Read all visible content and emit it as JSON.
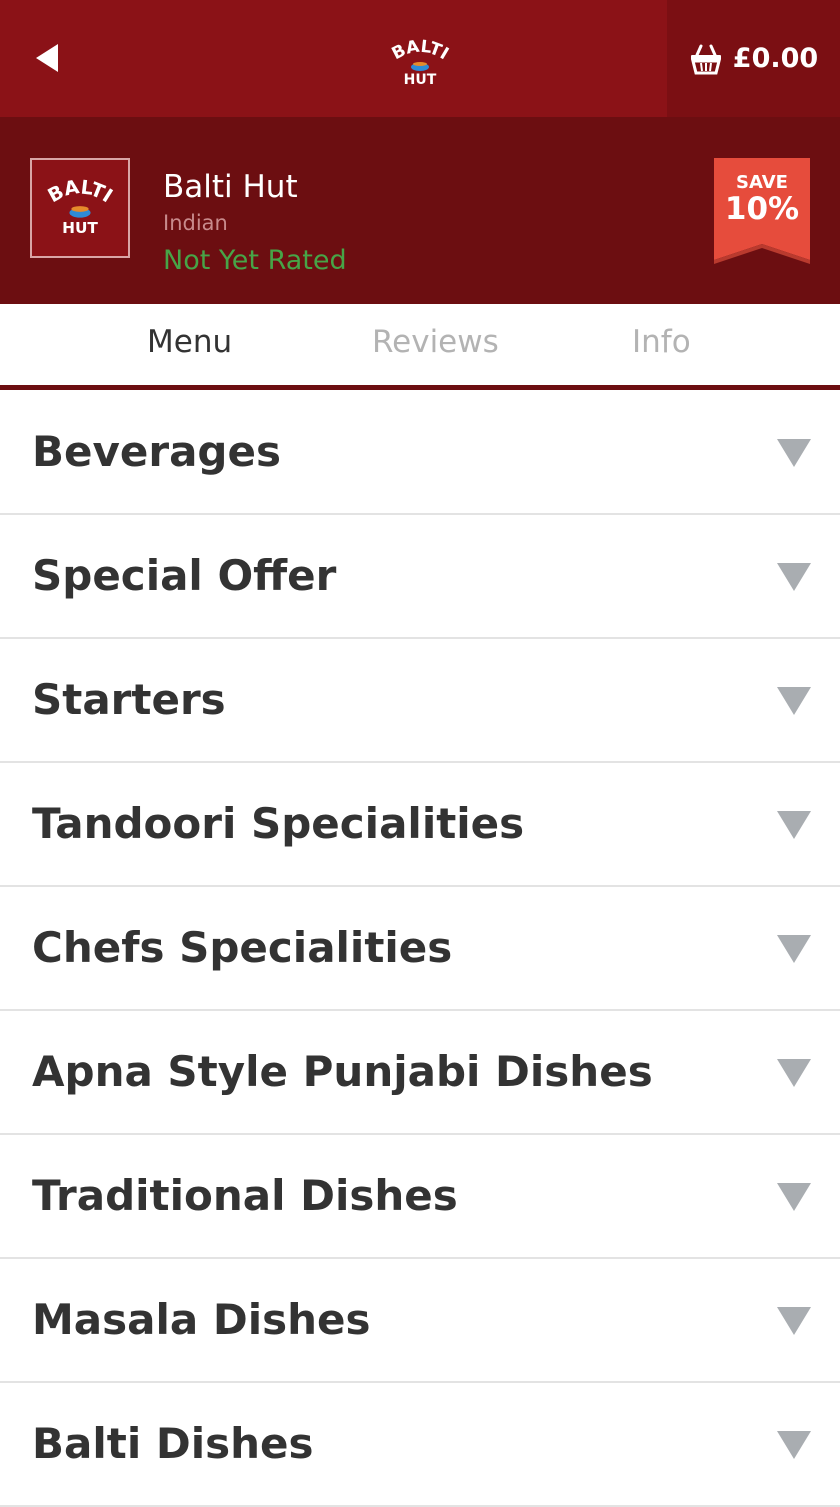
{
  "header": {
    "back_icon": "back-arrow-icon",
    "logo_text_top": "BALTI",
    "logo_text_bottom": "HUT",
    "cart_icon": "basket-icon",
    "cart_total": "£0.00"
  },
  "restaurant": {
    "name": "Balti Hut",
    "cuisine": "Indian",
    "rating": "Not Yet Rated",
    "logo_text_top": "BALTI",
    "logo_text_bottom": "HUT",
    "offer": {
      "label": "SAVE",
      "value": "10%"
    }
  },
  "tabs": [
    {
      "label": "Menu",
      "active": true
    },
    {
      "label": "Reviews",
      "active": false
    },
    {
      "label": "Info",
      "active": false
    }
  ],
  "categories": [
    "Beverages",
    "Special Offer",
    "Starters",
    "Tandoori Specialities",
    "Chefs Specialities",
    "Apna Style Punjabi Dishes",
    "Traditional Dishes",
    "Masala Dishes",
    "Balti Dishes"
  ],
  "colors": {
    "brand_red": "#8b1217",
    "header_dark": "#6c0e11",
    "rating_green": "#47a447",
    "offer_red": "#e64c3c"
  }
}
